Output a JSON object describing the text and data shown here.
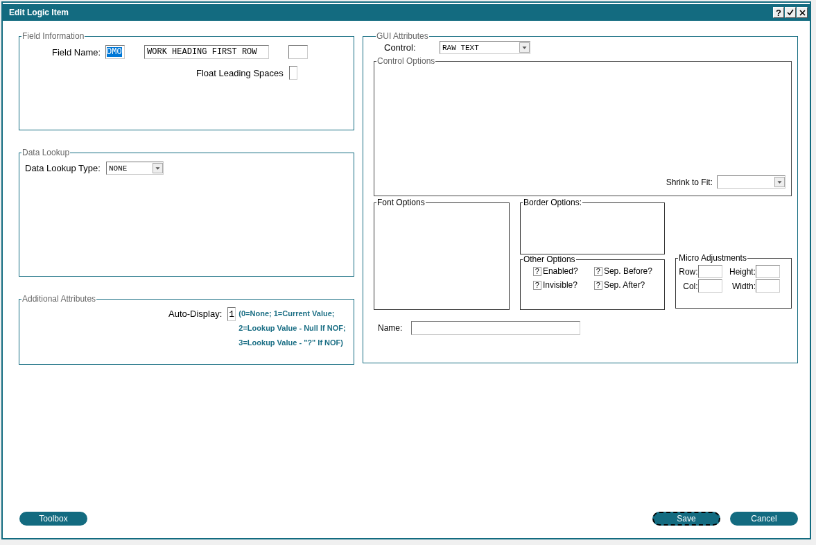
{
  "window": {
    "title": "Edit Logic Item",
    "title_buttons": [
      {
        "kind": "help",
        "text": "?"
      },
      {
        "kind": "ok"
      },
      {
        "kind": "close"
      }
    ]
  },
  "field_information": {
    "title": "Field Information",
    "field_name_label": "Field Name:",
    "field_code": "DMO",
    "field_code_highlighted": true,
    "field_description": "WORK HEADING FIRST ROW",
    "float_label": "Float Leading Spaces"
  },
  "data_lookup": {
    "title": "Data Lookup",
    "type_label": "Data Lookup Type:",
    "type_value": "NONE"
  },
  "additional_attributes": {
    "title": "Additional Attributes",
    "auto_display_label": "Auto-Display:",
    "auto_display_value": "1",
    "hints": [
      "(0=None; 1=Current Value;",
      "2=Lookup Value - Null If NOF;",
      "3=Lookup Value - \"?\" If NOF)"
    ]
  },
  "gui_attributes": {
    "title": "GUI Attributes",
    "control_label": "Control:",
    "control_value": "RAW TEXT",
    "control_options": {
      "title": "Control Options",
      "shrink_label": "Shrink to Fit:"
    },
    "font_options": {
      "title": "Font Options"
    },
    "border_options": {
      "title": "Border Options:"
    },
    "other_options": {
      "title": "Other Options",
      "checkboxes": [
        {
          "label": "Enabled?",
          "mark": "?"
        },
        {
          "label": "Sep. Before?",
          "mark": "?"
        },
        {
          "label": "Invisible?",
          "mark": "?"
        },
        {
          "label": "Sep. After?",
          "mark": "?"
        }
      ]
    },
    "micro_adjustments": {
      "title": "Micro Adjustments",
      "fields": [
        {
          "label": "Row:"
        },
        {
          "label": "Height:"
        },
        {
          "label": "Col:"
        },
        {
          "label": "Width:"
        }
      ]
    },
    "name_label": "Name:"
  },
  "buttons": [
    {
      "label": "Toolbox",
      "focused": false
    },
    {
      "label": "Save",
      "focused": true
    },
    {
      "label": "Cancel",
      "focused": false
    }
  ]
}
